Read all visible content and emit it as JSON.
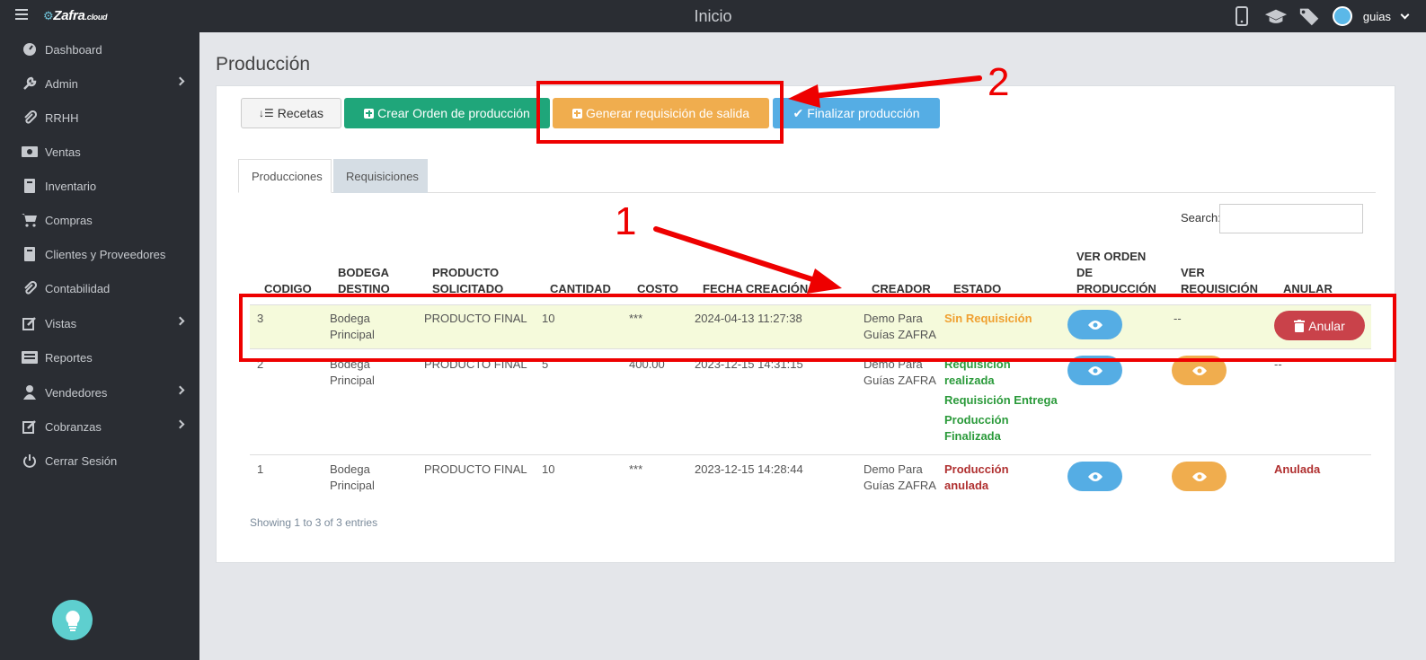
{
  "app": {
    "logo_text": "Zafra",
    "logo_suffix": ".cloud",
    "page_header": "Inicio",
    "user_name": "guias"
  },
  "sidebar": {
    "items": [
      {
        "label": "Dashboard",
        "icon": "dashboard-icon",
        "submenu": false
      },
      {
        "label": "Admin",
        "icon": "wrench-icon",
        "submenu": true
      },
      {
        "label": "RRHH",
        "icon": "paperclip-icon",
        "submenu": false
      },
      {
        "label": "Ventas",
        "icon": "money-icon",
        "submenu": false
      },
      {
        "label": "Inventario",
        "icon": "book-icon",
        "submenu": false
      },
      {
        "label": "Compras",
        "icon": "cart-icon",
        "submenu": false
      },
      {
        "label": "Clientes y Proveedores",
        "icon": "book-icon",
        "submenu": false
      },
      {
        "label": "Contabilidad",
        "icon": "paperclip-icon",
        "submenu": false
      },
      {
        "label": "Vistas",
        "icon": "edit-icon",
        "submenu": true
      },
      {
        "label": "Reportes",
        "icon": "list-icon",
        "submenu": false
      },
      {
        "label": "Vendedores",
        "icon": "user-icon",
        "submenu": true
      },
      {
        "label": "Cobranzas",
        "icon": "edit-icon",
        "submenu": true
      },
      {
        "label": "Cerrar Sesión",
        "icon": "power-icon",
        "submenu": false
      }
    ]
  },
  "main": {
    "title": "Producción",
    "buttons": {
      "recetas": "Recetas",
      "crear": "Crear Orden de producción",
      "generar": "Generar requisición de salida",
      "finalizar": "Finalizar producción"
    },
    "tabs": [
      "Producciones",
      "Requisiciones"
    ],
    "search_label": "Search:",
    "columns": {
      "codigo": "CODIGO",
      "bodega_1": "BODEGA",
      "bodega_2": "DESTINO",
      "producto_1": "PRODUCTO",
      "producto_2": "SOLICITADO",
      "cantidad": "CANTIDAD",
      "costo": "COSTO",
      "fecha": "FECHA CREACIÓN",
      "creador": "CREADOR",
      "estado": "ESTADO",
      "ver_orden_1": "VER ORDEN",
      "ver_orden_2": "DE",
      "ver_orden_3": "PRODUCCIÓN",
      "ver_req_1": "VER",
      "ver_req_2": "REQUISICIÓN",
      "anular": "ANULAR"
    },
    "rows": [
      {
        "codigo": "3",
        "bodega_1": "Bodega",
        "bodega_2": "Principal",
        "producto": "PRODUCTO FINAL",
        "cantidad": "10",
        "costo": "***",
        "fecha": "2024-04-13 11:27:38",
        "creador_1": "Demo Para",
        "creador_2": "Guías ZAFRA",
        "estado": "Sin Requisición",
        "ver_requisicion": "--",
        "anular": "Anular"
      },
      {
        "codigo": "2",
        "bodega_1": "Bodega",
        "bodega_2": "Principal",
        "producto": "PRODUCTO FINAL",
        "cantidad": "5",
        "costo": "400.00",
        "fecha": "2023-12-15 14:31:15",
        "creador_1": "Demo Para",
        "creador_2": "Guías ZAFRA",
        "estado_1a": "Requisición",
        "estado_1b": "realizada",
        "estado_2": "Requisición Entrega",
        "estado_3a": "Producción",
        "estado_3b": "Finalizada",
        "anular": "--"
      },
      {
        "codigo": "1",
        "bodega_1": "Bodega",
        "bodega_2": "Principal",
        "producto": "PRODUCTO FINAL",
        "cantidad": "10",
        "costo": "***",
        "fecha": "2023-12-15 14:28:44",
        "creador_1": "Demo Para",
        "creador_2": "Guías ZAFRA",
        "estado_a": "Producción",
        "estado_b": "anulada",
        "anular": "Anulada"
      }
    ],
    "footer": "Showing 1 to 3 of 3 entries"
  },
  "annotations": {
    "label_1": "1",
    "label_2": "2",
    "color": "#ee0000"
  },
  "colors": {
    "green": "#1fa67a",
    "orange": "#f0ad4e",
    "blue": "#55ade4",
    "red": "#c9424a",
    "sidebar": "#2a2d33"
  }
}
